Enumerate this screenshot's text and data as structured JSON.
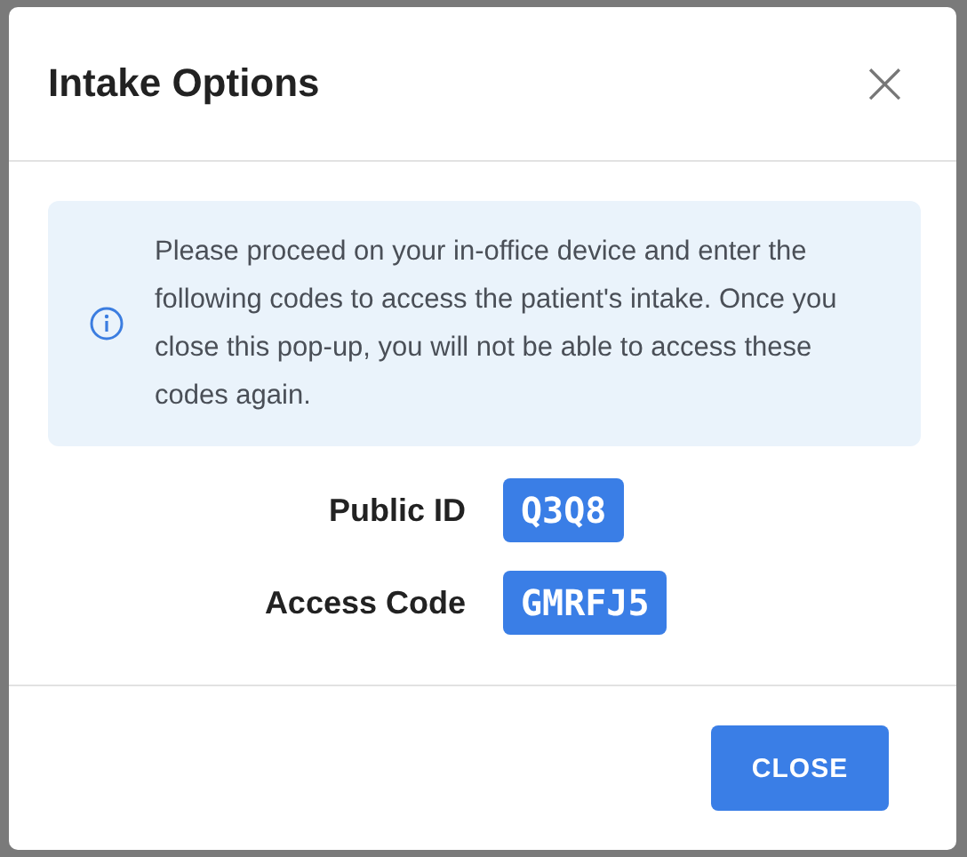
{
  "dialog": {
    "title": "Intake Options",
    "close_icon": "×"
  },
  "notice": {
    "text": "Please proceed on your in-office device and enter the following codes to access the patient's intake. Once you close this pop-up, you will not be able to access these codes again."
  },
  "codes": [
    {
      "label": "Public ID",
      "value": "Q3Q8"
    },
    {
      "label": "Access Code",
      "value": "GMRFJ5"
    }
  ],
  "buttons": [
    "CLOSE"
  ]
}
